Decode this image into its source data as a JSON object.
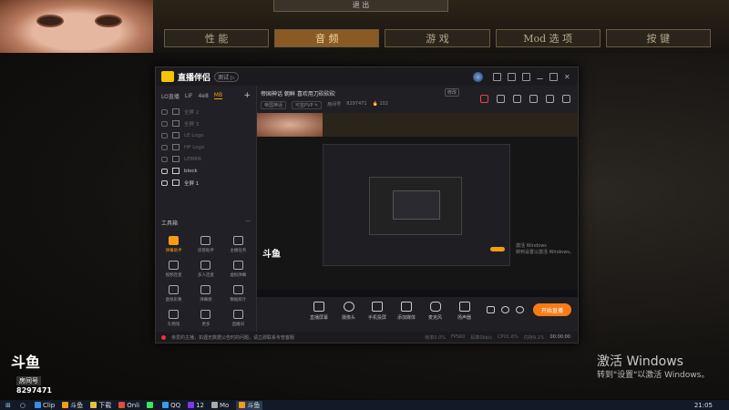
{
  "game": {
    "title_box": "退 出",
    "tabs": [
      {
        "label": "性 能",
        "active": false
      },
      {
        "label": "音 频",
        "active": true
      },
      {
        "label": "游 戏",
        "active": false
      },
      {
        "label": "Mod 选 项",
        "active": false
      },
      {
        "label": "按 键",
        "active": false
      }
    ]
  },
  "app": {
    "name": "直播伴侣",
    "badge": "测试 ▷",
    "scene_tabs": [
      {
        "label": "LO直播",
        "active": false
      },
      {
        "label": "LIF",
        "active": false
      },
      {
        "label": "4e8",
        "active": false
      },
      {
        "label": "MB",
        "active": true
      }
    ],
    "add_scene": "+",
    "sources": [
      {
        "label": "全屏 2",
        "on": false
      },
      {
        "label": "全屏 3",
        "on": false
      },
      {
        "label": "LE Logo",
        "on": false
      },
      {
        "label": "HP Logo",
        "on": false
      },
      {
        "label": "LEMRR",
        "on": false
      },
      {
        "label": "block",
        "on": true
      },
      {
        "label": "全屏 1",
        "on": true
      }
    ],
    "tools_header": "工具箱",
    "tools_more": "···",
    "tools": [
      {
        "label": "弹幕助手",
        "highlight": true
      },
      {
        "label": "房管助手",
        "highlight": false
      },
      {
        "label": "主播任务",
        "highlight": false
      },
      {
        "label": "视频连麦",
        "highlight": false
      },
      {
        "label": "多人连麦",
        "highlight": false
      },
      {
        "label": "虚拟弹幕",
        "highlight": false
      },
      {
        "label": "虚拟形象",
        "highlight": false
      },
      {
        "label": "弹幕姬",
        "highlight": false
      },
      {
        "label": "数据统计",
        "highlight": false
      },
      {
        "label": "礼物墙",
        "highlight": false
      },
      {
        "label": "更多",
        "highlight": false
      },
      {
        "label": "直播间",
        "highlight": false
      }
    ],
    "room_title": "帝国神话 朝鲜 喜欢用刀砍砍砍",
    "room_edit": "修改",
    "room_category": "帝国神话",
    "room_quality": "可蓝PVP ✎",
    "room_id_label": "房间号",
    "room_id": "8297471",
    "room_heat": "🔥 102",
    "preview": {
      "logo": "斗鱼",
      "activation": [
        "激活 Windows",
        "转到设置以激活 Windows。"
      ]
    },
    "controls": [
      {
        "label": "直播屏幕"
      },
      {
        "label": "摄像头"
      },
      {
        "label": "手机投屏"
      },
      {
        "label": "添加媒体"
      },
      {
        "label": "麦克风"
      },
      {
        "label": "扬声器"
      }
    ],
    "go_live": "开始直播",
    "status_text": "亲爱的主播，如遇无数据公告时的问题，请立即联系专管客服",
    "stats": [
      "帧率0.0%",
      "FPS60",
      "码率0kb/s",
      "CPU1.6%",
      "内存9.1%"
    ],
    "rec_time": "00:00:00"
  },
  "watermark": {
    "logo": "斗鱼",
    "room_label": "房间号",
    "room_id": "8297471"
  },
  "activation": {
    "title": "激活 Windows",
    "subtitle": "转到\"设置\"以激活 Windows。"
  },
  "taskbar": {
    "items": [
      {
        "label": "Clip",
        "color": "#3a8ee6"
      },
      {
        "label": "斗鱼",
        "color": "#f79a16"
      },
      {
        "label": "下载",
        "color": "#e6c23a"
      },
      {
        "label": "Onli",
        "color": "#e64a3a"
      },
      {
        "label": "",
        "color": "#3ae65a"
      },
      {
        "label": "QQ",
        "color": "#3a9be6"
      },
      {
        "label": "12",
        "color": "#7a3ae6"
      },
      {
        "label": "Mo",
        "color": "#aaaaaa"
      },
      {
        "label": "斗鱼",
        "color": "#f79a16"
      }
    ],
    "clock": "21:05"
  }
}
